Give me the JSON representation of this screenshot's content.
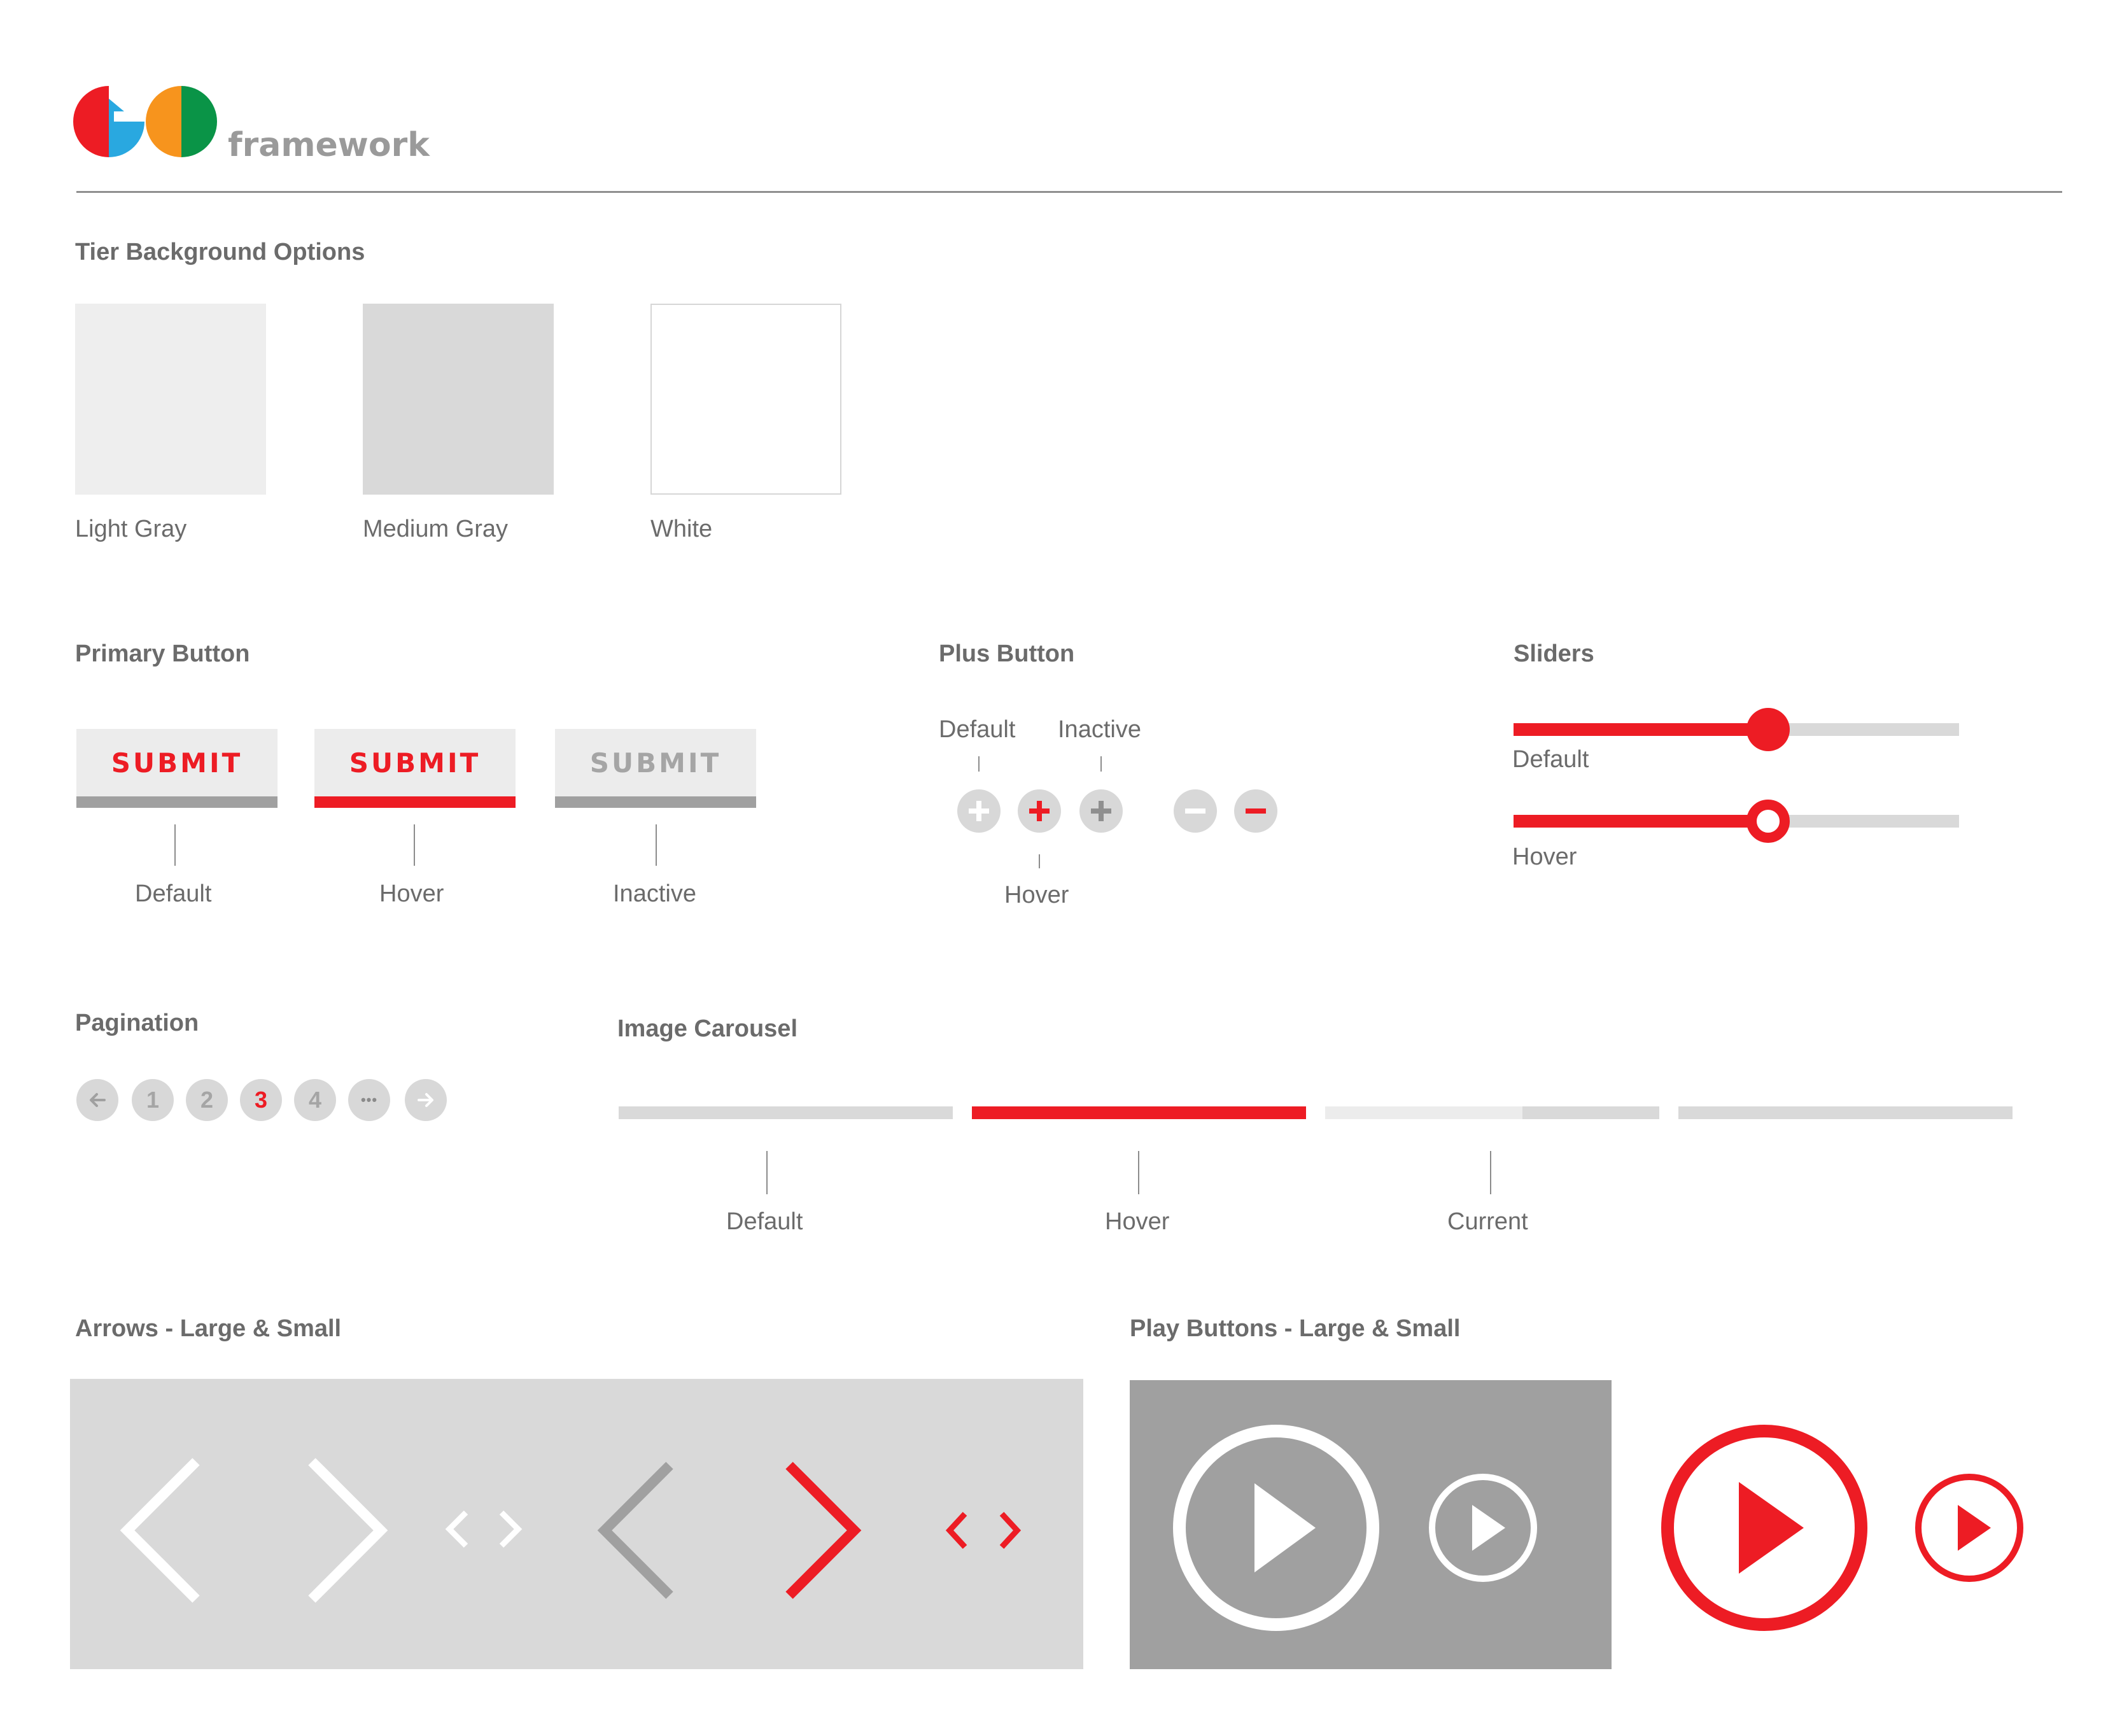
{
  "brand": {
    "logo_text": "GO",
    "wordmark": "framework",
    "colors": {
      "red": "#ed1c24",
      "blue": "#29a8e0",
      "orange": "#f7941d",
      "green": "#0a9447"
    }
  },
  "tier_backgrounds": {
    "title": "Tier Background Options",
    "options": [
      {
        "label": "Light Gray",
        "color": "#eeeeee"
      },
      {
        "label": "Medium Gray",
        "color": "#d9d9d9"
      },
      {
        "label": "White",
        "color": "#ffffff"
      }
    ]
  },
  "primary_button": {
    "title": "Primary Button",
    "button_label": "SUBMIT",
    "states": [
      "Default",
      "Hover",
      "Inactive"
    ]
  },
  "plus_button": {
    "title": "Plus Button",
    "default_label": "Default",
    "inactive_label": "Inactive",
    "hover_label": "Hover",
    "plus_glyph": "+",
    "minus_glyph": "−"
  },
  "sliders": {
    "title": "Sliders",
    "default_label": "Default",
    "hover_label": "Hover",
    "default_value": 0.57,
    "hover_value": 0.57
  },
  "pagination": {
    "title": "Pagination",
    "prev_glyph": "←",
    "pages": [
      "1",
      "2",
      "3",
      "4"
    ],
    "current_page": "3",
    "ellipsis": "•••",
    "next_glyph": "→"
  },
  "image_carousel": {
    "title": "Image Carousel",
    "states": [
      "Default",
      "Hover",
      "Current"
    ],
    "current_progress": 0.59
  },
  "arrows": {
    "title": "Arrows - Large & Small",
    "small_left_glyph": "<",
    "small_right_glyph": ">"
  },
  "play_buttons": {
    "title": "Play Buttons - Large & Small"
  },
  "colors": {
    "accent": "#ed1c24",
    "gray": "#a0a0a0",
    "text": "#6b6b6b",
    "light_panel": "#d9d9d9",
    "dark_panel": "#a0a0a0"
  }
}
